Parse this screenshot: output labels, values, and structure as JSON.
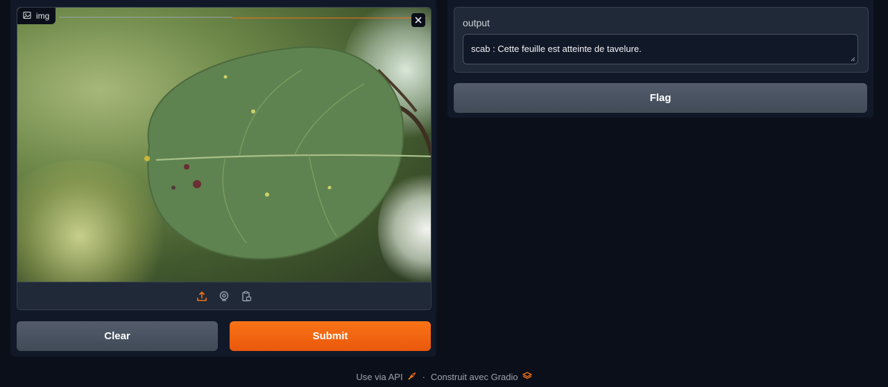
{
  "input": {
    "image_label": "img"
  },
  "buttons": {
    "clear": "Clear",
    "submit": "Submit",
    "flag": "Flag"
  },
  "output": {
    "label": "output",
    "text": "scab : Cette feuille est atteinte de tavelure."
  },
  "footer": {
    "api_link": "Use via API",
    "separator": "·",
    "built_with": "Construit avec Gradio"
  },
  "colors": {
    "accent": "#f97316",
    "background": "#0b0f19",
    "panel": "#111827"
  },
  "icons": {
    "image_label": "image-icon",
    "close": "close-icon",
    "sources": [
      "upload-icon",
      "webcam-icon",
      "clipboard-icon"
    ],
    "api": "rocket-icon",
    "gradio": "gradio-logo-icon"
  }
}
